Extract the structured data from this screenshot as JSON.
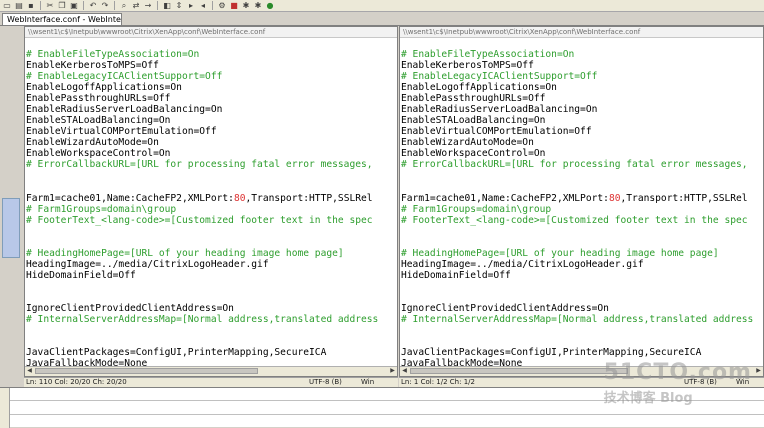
{
  "tabs": [
    "WebInterface.conf - WebInterface.conf"
  ],
  "left_pane": {
    "path": "\\\\wsent1\\c$\\Inetpub\\wwwroot\\Citrix\\XenApp\\conf\\WebInterface.conf",
    "lines": [
      {
        "t": "# EnableFileTypeAssociation=On",
        "k": "c"
      },
      {
        "t": "EnableKerberosToMPS=Off",
        "k": "n"
      },
      {
        "t": "# EnableLegacyICAClientSupport=Off",
        "k": "c"
      },
      {
        "t": "EnableLogoffApplications=On",
        "k": "n"
      },
      {
        "t": "EnablePassthroughURLs=Off",
        "k": "n"
      },
      {
        "t": "EnableRadiusServerLoadBalancing=On",
        "k": "n"
      },
      {
        "t": "EnableSTALoadBalancing=On",
        "k": "n"
      },
      {
        "t": "EnableVirtualCOMPortEmulation=Off",
        "k": "n"
      },
      {
        "t": "EnableWizardAutoMode=On",
        "k": "n"
      },
      {
        "t": "EnableWorkspaceControl=On",
        "k": "n"
      },
      {
        "t": "# ErrorCallbackURL=[URL for processing fatal error messages,",
        "k": "c"
      },
      {
        "t": "",
        "k": "n"
      },
      {
        "t": "",
        "k": "n"
      },
      {
        "t": "Farm1=cache01,Name:CacheFP2,XMLPort:80,Transport:HTTP,SSLRel",
        "k": "n"
      },
      {
        "t": "# Farm1Groups=domain\\group",
        "k": "c"
      },
      {
        "t": "# FooterText_<lang-code>=[Customized footer text in the spec",
        "k": "c"
      },
      {
        "t": "",
        "k": "n"
      },
      {
        "t": "",
        "k": "n"
      },
      {
        "t": "# HeadingHomePage=[URL of your heading image home page]",
        "k": "c"
      },
      {
        "t": "HeadingImage=../media/CitrixLogoHeader.gif",
        "k": "n"
      },
      {
        "t": "HideDomainField=Off",
        "k": "n"
      },
      {
        "t": "",
        "k": "n"
      },
      {
        "t": "",
        "k": "n"
      },
      {
        "t": "IgnoreClientProvidedClientAddress=On",
        "k": "n"
      },
      {
        "t": "# InternalServerAddressMap=[Normal address,translated address",
        "k": "c"
      },
      {
        "t": "",
        "k": "n"
      },
      {
        "t": "",
        "k": "n"
      },
      {
        "t": "JavaClientPackages=ConfigUI,PrinterMapping,SecureICA",
        "k": "n"
      },
      {
        "t": "JavaFallbackMode=None",
        "k": "n"
      }
    ]
  },
  "right_pane": {
    "path": "\\\\wsent1\\c$\\Inetpub\\wwwroot\\Citrix\\XenApp\\conf\\WebInterface.conf",
    "lines": [
      {
        "t": "# EnableFileTypeAssociation=On",
        "k": "c"
      },
      {
        "t": "EnableKerberosToMPS=Off",
        "k": "n"
      },
      {
        "t": "# EnableLegacyICAClientSupport=Off",
        "k": "c"
      },
      {
        "t": "EnableLogoffApplications=On",
        "k": "n"
      },
      {
        "t": "EnablePassthroughURLs=Off",
        "k": "n"
      },
      {
        "t": "EnableRadiusServerLoadBalancing=On",
        "k": "n"
      },
      {
        "t": "EnableSTALoadBalancing=On",
        "k": "n"
      },
      {
        "t": "EnableVirtualCOMPortEmulation=Off",
        "k": "n"
      },
      {
        "t": "EnableWizardAutoMode=On",
        "k": "n"
      },
      {
        "t": "EnableWorkspaceControl=On",
        "k": "n"
      },
      {
        "t": "# ErrorCallbackURL=[URL for processing fatal error messages,",
        "k": "c"
      },
      {
        "t": "",
        "k": "n"
      },
      {
        "t": "",
        "k": "n"
      },
      {
        "t": "Farm1=cache01,Name:CacheFP2,XMLPort:80,Transport:HTTP,SSLRel",
        "k": "n"
      },
      {
        "t": "# Farm1Groups=domain\\group",
        "k": "c"
      },
      {
        "t": "# FooterText_<lang-code>=[Customized footer text in the spec",
        "k": "c"
      },
      {
        "t": "",
        "k": "n"
      },
      {
        "t": "",
        "k": "n"
      },
      {
        "t": "# HeadingHomePage=[URL of your heading image home page]",
        "k": "c"
      },
      {
        "t": "HeadingImage=../media/CitrixLogoHeader.gif",
        "k": "n"
      },
      {
        "t": "HideDomainField=Off",
        "k": "n"
      },
      {
        "t": "",
        "k": "n"
      },
      {
        "t": "",
        "k": "n"
      },
      {
        "t": "IgnoreClientProvidedClientAddress=On",
        "k": "n"
      },
      {
        "t": "# InternalServerAddressMap=[Normal address,translated address",
        "k": "c"
      },
      {
        "t": "",
        "k": "n"
      },
      {
        "t": "",
        "k": "n"
      },
      {
        "t": "JavaClientPackages=ConfigUI,PrinterMapping,SecureICA",
        "k": "n"
      },
      {
        "t": "JavaFallbackMode=None",
        "k": "n"
      }
    ]
  },
  "status_left": {
    "position": "Ln: 110  Col: 20/20  Ch: 20/20",
    "encoding": "UTF-8 (B)",
    "eol": "Win"
  },
  "status_right": {
    "position": "Ln: 1  Col: 1/2  Ch: 1/2",
    "encoding": "UTF-8 (B)",
    "eol": "Win"
  },
  "watermark": {
    "main": "51CTO.com",
    "sub": "技术博客  Blog"
  },
  "colors": {
    "comment": "#2e9e2e",
    "number": "#dd3333"
  }
}
